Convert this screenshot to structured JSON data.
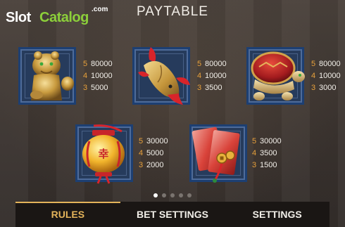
{
  "watermark": {
    "slot": "Slot",
    "catalog": "Catalog",
    "com": ".com"
  },
  "title": "PAYTABLE",
  "symbols": [
    {
      "name": "foo-dog",
      "icon": "golden-lion-icon",
      "pays": [
        {
          "count": "5",
          "value": "80000"
        },
        {
          "count": "4",
          "value": "10000"
        },
        {
          "count": "3",
          "value": "5000"
        }
      ]
    },
    {
      "name": "koi-fish",
      "icon": "golden-koi-icon",
      "pays": [
        {
          "count": "5",
          "value": "80000"
        },
        {
          "count": "4",
          "value": "10000"
        },
        {
          "count": "3",
          "value": "3500"
        }
      ]
    },
    {
      "name": "turtle",
      "icon": "golden-turtle-icon",
      "pays": [
        {
          "count": "5",
          "value": "80000"
        },
        {
          "count": "4",
          "value": "10000"
        },
        {
          "count": "3",
          "value": "3000"
        }
      ]
    },
    {
      "name": "lantern",
      "icon": "red-lantern-icon",
      "pays": [
        {
          "count": "5",
          "value": "30000"
        },
        {
          "count": "4",
          "value": "5000"
        },
        {
          "count": "3",
          "value": "2000"
        }
      ]
    },
    {
      "name": "red-envelopes",
      "icon": "red-envelope-icon",
      "pays": [
        {
          "count": "5",
          "value": "30000"
        },
        {
          "count": "4",
          "value": "3500"
        },
        {
          "count": "3",
          "value": "1500"
        }
      ]
    }
  ],
  "pager": {
    "pages": 5,
    "active": 0
  },
  "tabs": [
    {
      "label": "RULES",
      "active": true
    },
    {
      "label": "BET SETTINGS",
      "active": false
    },
    {
      "label": "SETTINGS",
      "active": false
    }
  ],
  "colors": {
    "count": "#e8a13c",
    "active_tab": "#e3b35a",
    "frame": "#1d3f72"
  }
}
